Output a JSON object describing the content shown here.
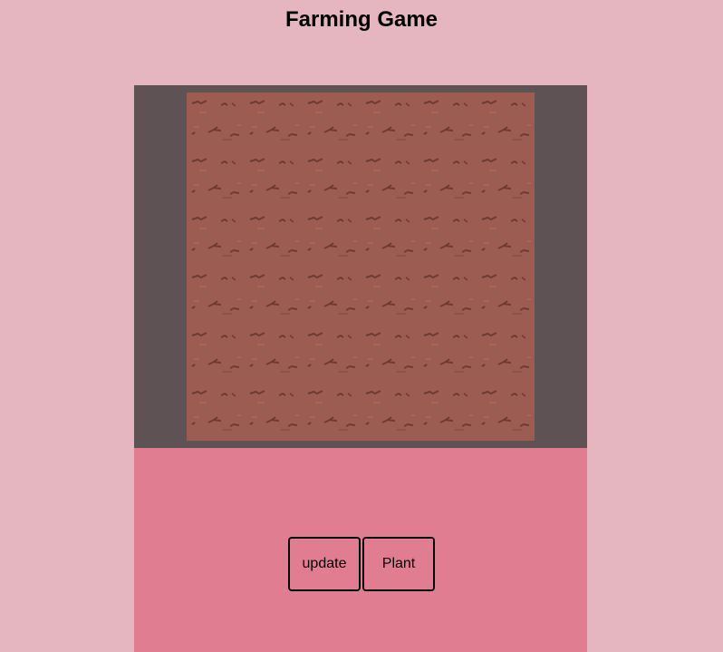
{
  "header": {
    "title": "Farming Game"
  },
  "field": {
    "tile_texture": "dirt-tile-texture",
    "soil_color": "#9c5c52",
    "frame_color": "#5e5254"
  },
  "controls": {
    "update_label": "update",
    "plant_label": "Plant",
    "panel_color": "#e07d90"
  }
}
